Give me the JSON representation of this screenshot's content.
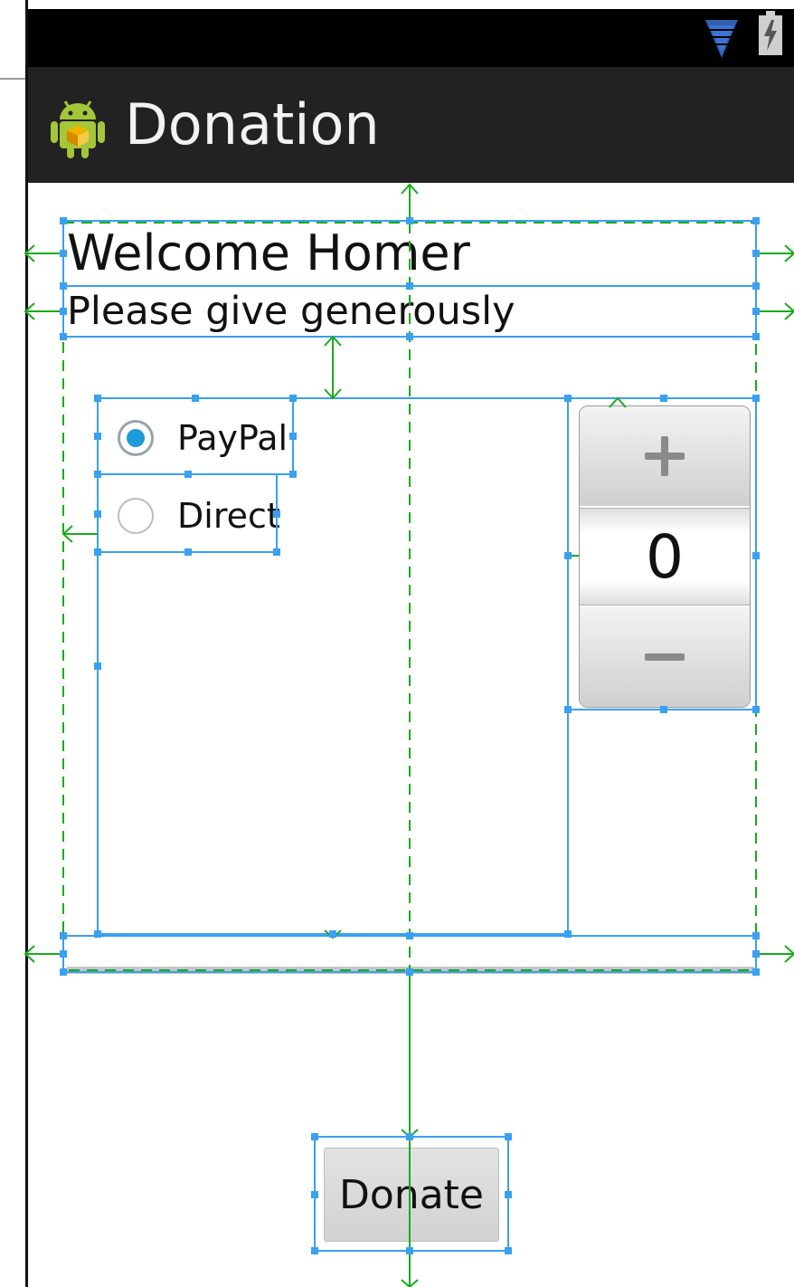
{
  "app": {
    "title": "Donation"
  },
  "status_bar": {
    "icons": [
      "wifi-icon",
      "battery-charging-icon"
    ]
  },
  "content": {
    "welcome": "Welcome Homer",
    "subtitle": "Please give generously"
  },
  "payment_methods": [
    {
      "label": "PayPal",
      "checked": true
    },
    {
      "label": "Direct",
      "checked": false
    }
  ],
  "amount_picker": {
    "value": "0",
    "increment_icon": "plus-icon",
    "decrement_icon": "minus-icon"
  },
  "progress": {
    "value": 0
  },
  "donate_button": {
    "label": "Donate"
  },
  "colors": {
    "action_bar": "#222222",
    "accent": "#1d9bd8",
    "selection_outline": "#3aa0f0",
    "guide_green": "#1aab1a"
  }
}
